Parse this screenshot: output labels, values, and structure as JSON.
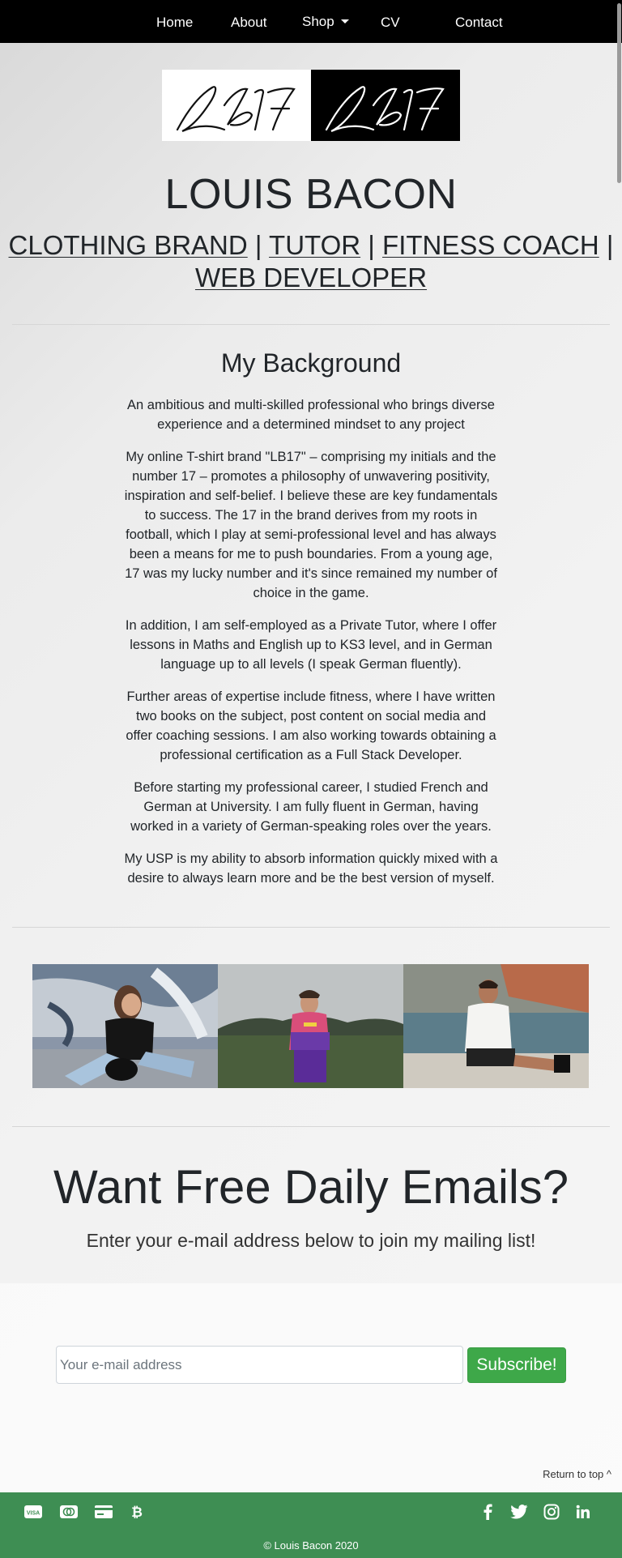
{
  "nav": {
    "home": "Home",
    "about": "About",
    "shop": "Shop",
    "cv": "CV",
    "contact": "Contact"
  },
  "header": {
    "title": "LOUIS BACON",
    "roles": [
      "CLOTHING BRAND",
      "TUTOR",
      "FITNESS COACH",
      "WEB DEVELOPER"
    ],
    "separator": "|"
  },
  "background": {
    "heading": "My Background",
    "paragraphs": [
      "An ambitious and multi-skilled professional who brings diverse experience and a determined mindset to any project",
      "My online T-shirt brand \"LB17\" – comprising my initials and the number 17 – promotes a philosophy of unwavering positivity, inspiration and self-belief. I believe these are key fundamentals to success. The 17 in the brand derives from my roots in football, which I play at semi-professional level and has always been a means for me to push boundaries. From a young age, 17 was my lucky number and it's since remained my number of choice in the game.",
      "In addition, I am self-employed as a Private Tutor, where I offer lessons in Maths and English up to KS3 level, and in German language up to all levels (I speak German fluently).",
      "Further areas of expertise include fitness, where I have written two books on the subject, post content on social media and offer coaching sessions. I am also working towards obtaining a professional certification as a Full Stack Developer.",
      "Before starting my professional career, I studied French and German at University. I am fully fluent in German, having worked in a variety of German-speaking roles over the years.",
      "My USP is my ability to absorb information quickly mixed with a desire to always learn more and be the best version of myself."
    ]
  },
  "cta": {
    "title": "Want Free Daily Emails?",
    "subtitle": "Enter your e-mail address below to join my mailing list!",
    "placeholder": "Your e-mail address",
    "button": "Subscribe!"
  },
  "return_to_top": "Return to top ^",
  "footer": {
    "copyright": "© Louis Bacon 2020",
    "payment_icons": [
      "visa-icon",
      "mastercard-icon",
      "credit-card-icon",
      "bitcoin-icon"
    ],
    "social_icons": [
      "facebook-icon",
      "twitter-icon",
      "instagram-icon",
      "linkedin-icon"
    ]
  },
  "colors": {
    "nav_bg": "#000000",
    "footer_bg": "#3e8e53",
    "subscribe_bg": "#3ea849"
  }
}
